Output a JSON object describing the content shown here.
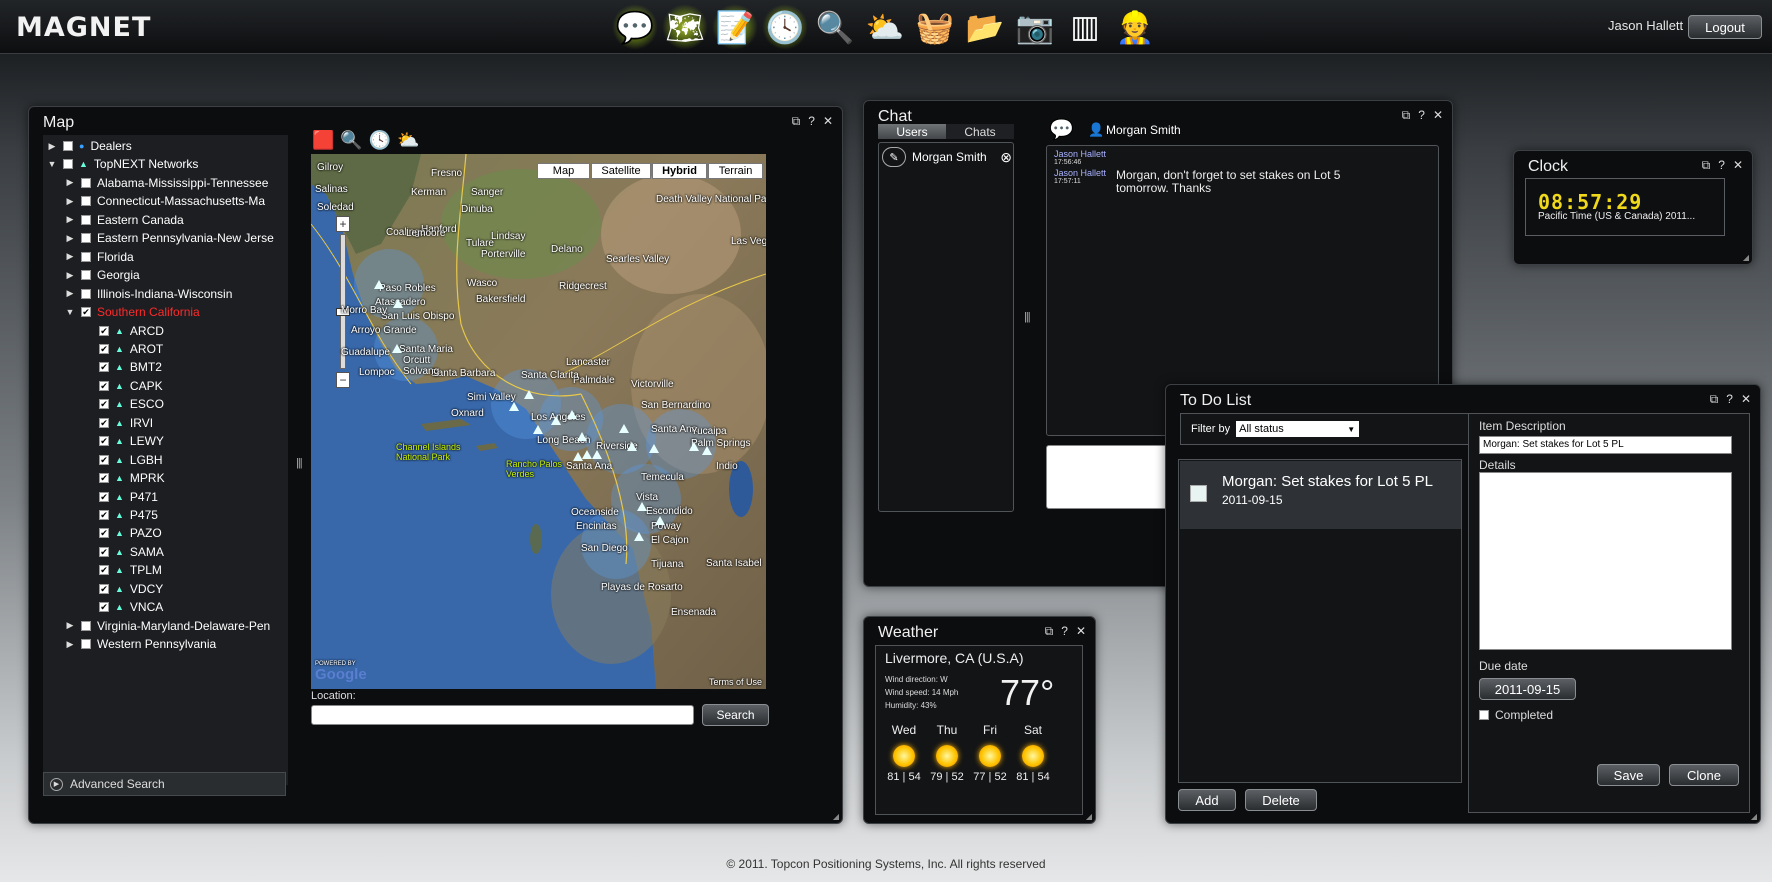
{
  "topbar": {
    "logo": "MAGNET",
    "apps": [
      {
        "icon": "chat-app-icon",
        "glyph": "💬",
        "glow": true
      },
      {
        "icon": "map-app-icon",
        "glyph": "🗺",
        "glow": true
      },
      {
        "icon": "notepad-app-icon",
        "glyph": "📝",
        "glow": true
      },
      {
        "icon": "clock-app-icon",
        "glyph": "🕓",
        "glow": true
      },
      {
        "icon": "search-app-icon",
        "glyph": "🔍",
        "glow": false
      },
      {
        "icon": "weather-app-icon",
        "glyph": "⛅",
        "glow": false
      },
      {
        "icon": "basket-app-icon",
        "glyph": "🧺",
        "glow": false
      },
      {
        "icon": "folders-app-icon",
        "glyph": "📂",
        "glow": false
      },
      {
        "icon": "survey-instrument-app-icon",
        "glyph": "📷",
        "glow": false
      },
      {
        "icon": "barcode-app-icon",
        "glyph": "▥",
        "glow": false
      },
      {
        "icon": "user-settings-app-icon",
        "glyph": "👷",
        "glow": false
      }
    ],
    "user_name": "Jason Hallett",
    "logout_label": "Logout"
  },
  "map_panel": {
    "title": "Map",
    "tree": [
      {
        "label": "Dealers",
        "level": 0,
        "expander": "▶",
        "checked": false,
        "marker": "●",
        "color": "#ffffff"
      },
      {
        "label": "TopNEXT Networks",
        "level": 0,
        "expander": "▼",
        "checked": false,
        "marker": "▲",
        "color": "#ffffff"
      },
      {
        "label": "Alabama-Mississippi-Tennessee",
        "level": 1,
        "expander": "▶",
        "checked": false,
        "color": "#ffffff"
      },
      {
        "label": "Connecticut-Massachusetts-Ma",
        "level": 1,
        "expander": "▶",
        "checked": false,
        "color": "#ffffff"
      },
      {
        "label": "Eastern Canada",
        "level": 1,
        "expander": "▶",
        "checked": false,
        "color": "#ffffff"
      },
      {
        "label": "Eastern Pennsylvania-New Jerse",
        "level": 1,
        "expander": "▶",
        "checked": false,
        "color": "#ffffff"
      },
      {
        "label": "Florida",
        "level": 1,
        "expander": "▶",
        "checked": false,
        "color": "#ffffff"
      },
      {
        "label": "Georgia",
        "level": 1,
        "expander": "▶",
        "checked": false,
        "color": "#ffffff"
      },
      {
        "label": "Illinois-Indiana-Wisconsin",
        "level": 1,
        "expander": "▶",
        "checked": false,
        "color": "#ffffff"
      },
      {
        "label": "Southern California",
        "level": 1,
        "expander": "▼",
        "checked": true,
        "color": "#ff2a2a"
      },
      {
        "label": "ARCD",
        "level": 2,
        "checked": true,
        "marker": "▲",
        "color": "#ffffff"
      },
      {
        "label": "AROT",
        "level": 2,
        "checked": true,
        "marker": "▲",
        "color": "#ffffff"
      },
      {
        "label": "BMT2",
        "level": 2,
        "checked": true,
        "marker": "▲",
        "color": "#ffffff"
      },
      {
        "label": "CAPK",
        "level": 2,
        "checked": true,
        "marker": "▲",
        "color": "#ffffff"
      },
      {
        "label": "ESCO",
        "level": 2,
        "checked": true,
        "marker": "▲",
        "color": "#ffffff"
      },
      {
        "label": "IRVI",
        "level": 2,
        "checked": true,
        "marker": "▲",
        "color": "#ffffff"
      },
      {
        "label": "LEWY",
        "level": 2,
        "checked": true,
        "marker": "▲",
        "color": "#ffffff"
      },
      {
        "label": "LGBH",
        "level": 2,
        "checked": true,
        "marker": "▲",
        "color": "#ffffff"
      },
      {
        "label": "MPRK",
        "level": 2,
        "checked": true,
        "marker": "▲",
        "color": "#ffffff"
      },
      {
        "label": "P471",
        "level": 2,
        "checked": true,
        "marker": "▲",
        "color": "#ffffff"
      },
      {
        "label": "P475",
        "level": 2,
        "checked": true,
        "marker": "▲",
        "color": "#ffffff"
      },
      {
        "label": "PAZO",
        "level": 2,
        "checked": true,
        "marker": "▲",
        "color": "#ffffff"
      },
      {
        "label": "SAMA",
        "level": 2,
        "checked": true,
        "marker": "▲",
        "color": "#ffffff"
      },
      {
        "label": "TPLM",
        "level": 2,
        "checked": true,
        "marker": "▲",
        "color": "#ffffff"
      },
      {
        "label": "VDCY",
        "level": 2,
        "checked": true,
        "marker": "▲",
        "color": "#ffffff"
      },
      {
        "label": "VNCA",
        "level": 2,
        "checked": true,
        "marker": "▲",
        "color": "#ffffff"
      },
      {
        "label": "Virginia-Maryland-Delaware-Pen",
        "level": 1,
        "expander": "▶",
        "checked": false,
        "color": "#ffffff"
      },
      {
        "label": "Western Pennsylvania",
        "level": 1,
        "expander": "▶",
        "checked": false,
        "color": "#ffffff"
      }
    ],
    "advanced_search_label": "Advanced Search",
    "map_types": [
      "Map",
      "Satellite",
      "Hybrid",
      "Terrain"
    ],
    "active_map_type": "Hybrid",
    "zoom_in": "+",
    "zoom_out": "−",
    "map_labels": [
      "Gilroy",
      "Salinas",
      "Fresno",
      "Kerman",
      "Sanger",
      "Soledad",
      "Dinuba",
      "Hanford",
      "Tulare",
      "Coalinga",
      "Lindsay",
      "Porterville",
      "Delano",
      "Wasco",
      "Bakersfield",
      "Paso Robles",
      "Atascadero",
      "San Luis Obispo",
      "Santa Maria",
      "Lompoc",
      "Orcutt",
      "Santa Barbara",
      "Oxnard",
      "Simi Valley",
      "Lancaster",
      "Palmdale",
      "Victorville",
      "Santa Clarita",
      "Los Angeles",
      "Long Beach",
      "Riverside",
      "San Bernardino",
      "Santa Ana",
      "Yucaipa",
      "Palm Springs",
      "Indio",
      "Temecula",
      "Oceanside",
      "Escondido",
      "Vista",
      "Encinitas",
      "El Cajon",
      "Poway",
      "San Diego",
      "Tijuana",
      "Santa Isabel",
      "Playas de Rosarto",
      "Ensenada",
      "Rancho Palos Verdes",
      "Channel Islands National Park",
      "Death Valley National Park",
      "Ridgecrest",
      "Searles Valley",
      "Las Vegas",
      "Morro Bay",
      "Arroyo Grande",
      "Guadalupe",
      "Solvang",
      "Lemoore",
      "Santa Ana"
    ],
    "google_logo": "Google",
    "powered_by": "POWERED BY",
    "terms": "Terms of Use",
    "location_label": "Location:",
    "location_value": "",
    "search_label": "Search"
  },
  "chat_panel": {
    "title": "Chat",
    "tabs": [
      "Users",
      "Chats"
    ],
    "active_tab": "Users",
    "users": [
      {
        "name": "Morgan Smith"
      }
    ],
    "chat_with": "Morgan Smith",
    "messages": [
      {
        "sender": "Jason Hallett",
        "time": "17:56:46",
        "text": ""
      },
      {
        "sender": "Jason Hallett",
        "time": "17:57:11",
        "text": "Morgan, don't forget to set stakes on Lot 5 tomorrow. Thanks"
      }
    ],
    "input_value": ""
  },
  "clock_panel": {
    "title": "Clock",
    "time": "08:57:29",
    "timezone": "Pacific Time (US & Canada) 2011..."
  },
  "weather_panel": {
    "title": "Weather",
    "location": "Livermore, CA (U.S.A)",
    "wind_direction": "Wind direction: W",
    "wind_speed": "Wind speed: 14 Mph",
    "humidity": "Humidity: 43%",
    "temperature": "77°",
    "forecast": [
      {
        "day": "Wed",
        "icon": "sun-icon",
        "temps": "81 | 54"
      },
      {
        "day": "Thu",
        "icon": "sun-icon",
        "temps": "79 | 52"
      },
      {
        "day": "Fri",
        "icon": "sun-icon",
        "temps": "77 | 52"
      },
      {
        "day": "Sat",
        "icon": "sun-icon",
        "temps": "81 | 54"
      }
    ]
  },
  "todo_panel": {
    "title": "To Do List",
    "filter_label": "Filter by",
    "filter_value": "All status",
    "items": [
      {
        "title": "Morgan: Set stakes for Lot 5 PL",
        "date": "2011-09-15",
        "completed": false
      }
    ],
    "add_label": "Add",
    "delete_label": "Delete",
    "item_description_label": "Item Description",
    "item_description_value": "Morgan: Set stakes for Lot 5 PL",
    "details_label": "Details",
    "details_value": "",
    "due_date_label": "Due date",
    "due_date_value": "2011-09-15",
    "completed_label": "Completed",
    "completed": false,
    "save_label": "Save",
    "clone_label": "Clone"
  },
  "footer": {
    "copyright": "© 2011. Topcon Positioning Systems, Inc.  All rights reserved"
  }
}
